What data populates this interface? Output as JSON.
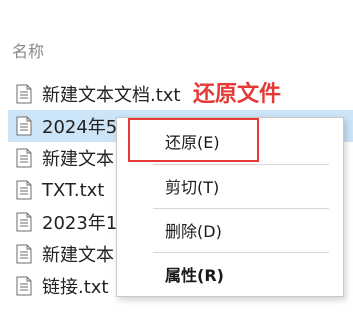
{
  "header": {
    "name_column": "名称"
  },
  "files": [
    {
      "name": "新建文本文档.txt",
      "icon": "text-file-icon"
    },
    {
      "name": "2024年5",
      "icon": "text-file-icon",
      "selected": true
    },
    {
      "name": "新建文本",
      "icon": "text-file-icon"
    },
    {
      "name": "TXT.txt",
      "icon": "text-file-icon"
    },
    {
      "name": "2023年1",
      "icon": "text-file-icon"
    },
    {
      "name": "新建文本",
      "icon": "text-file-icon"
    },
    {
      "name": "链接.txt",
      "icon": "text-file-icon"
    }
  ],
  "annotation": {
    "text": "还原文件",
    "color": "#e53935"
  },
  "context_menu": {
    "items": [
      {
        "label": "还原(E)",
        "bold": false
      },
      {
        "label": "剪切(T)",
        "bold": false
      },
      {
        "label": "删除(D)",
        "bold": false
      },
      {
        "label": "属性(R)",
        "bold": true
      }
    ]
  },
  "colors": {
    "selection": "#cce4f7",
    "highlight": "#e53935"
  }
}
